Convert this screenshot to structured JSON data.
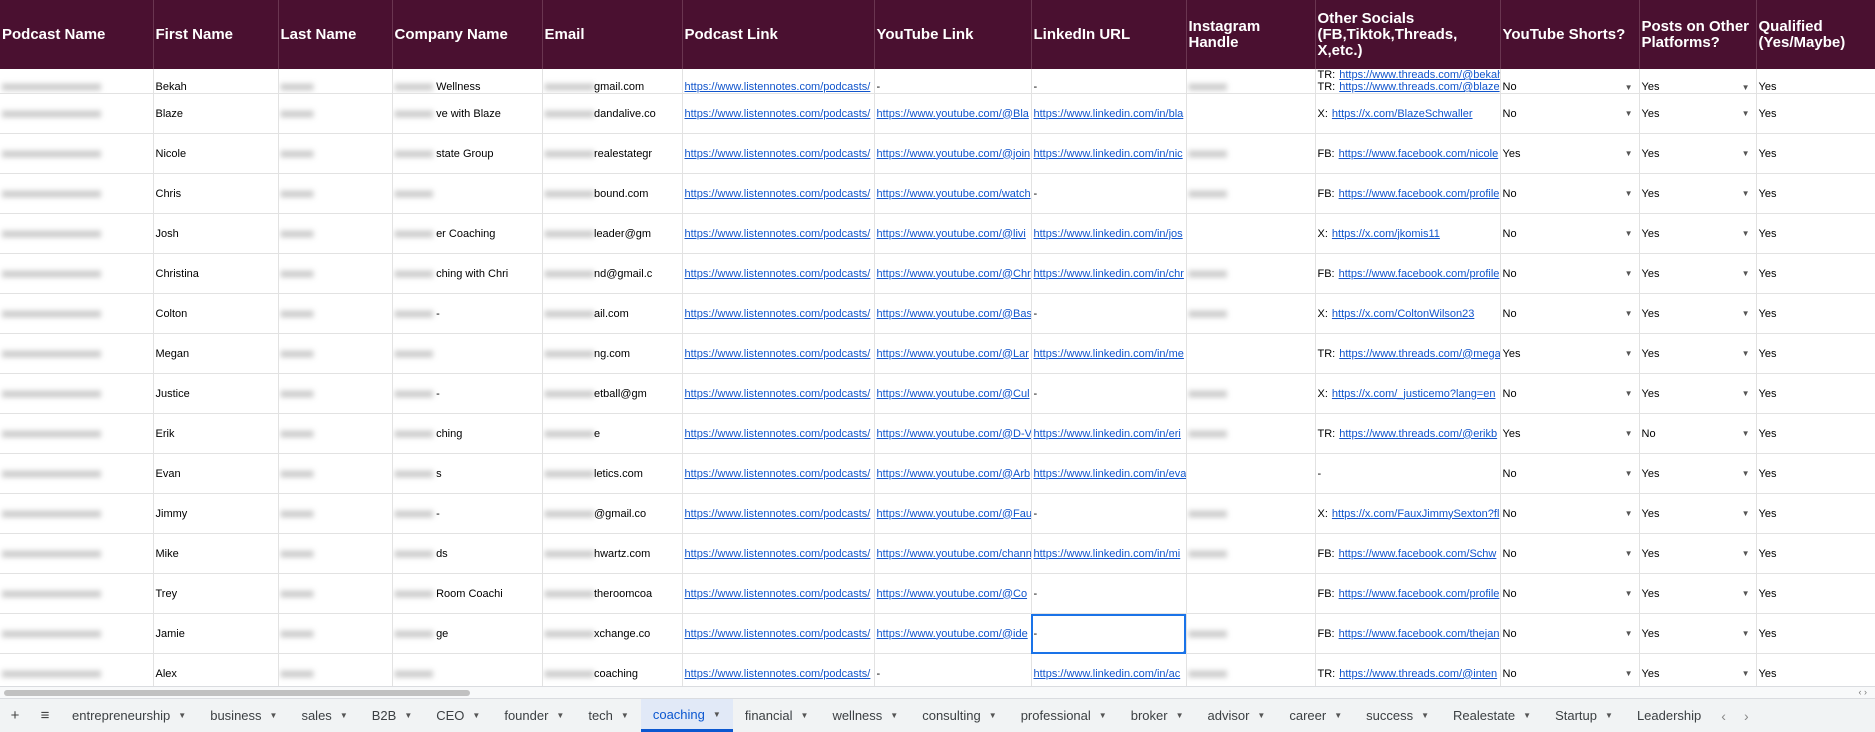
{
  "columns": [
    "Podcast Name",
    "First Name",
    "Last Name",
    "Company Name",
    "Email",
    "Podcast Link",
    "YouTube Link",
    "LinkedIn URL",
    "Instagram Handle",
    "Other Socials (FB,Tiktok,Threads, X,etc.)",
    "YouTube Shorts?",
    "Posts on Other Platforms?",
    "Qualified (Yes/Maybe)"
  ],
  "rows": [
    {
      "podcast": "",
      "first": "Bekah",
      "last": "",
      "company": "Wellness",
      "email": "gmail.com",
      "podcast_link": "https://www.listennotes.com/podcasts/",
      "youtube": "-",
      "linkedin": "-",
      "instagram": "",
      "socials": [
        {
          "label": "TR:",
          "url": "https://www.threads.com/@bekah"
        },
        {
          "label": "TR:",
          "url": "https://www.threads.com/@blaze"
        }
      ],
      "shorts": "No",
      "posts": "Yes",
      "qualified": "Yes"
    },
    {
      "podcast": "",
      "first": "Blaze",
      "last": "",
      "company": "ve with Blaze",
      "email": "dandalive.co",
      "podcast_link": "https://www.listennotes.com/podcasts/",
      "youtube": "https://www.youtube.com/@Bla",
      "linkedin": "https://www.linkedin.com/in/bla",
      "instagram": "",
      "socials": [
        {
          "label": "X:",
          "url": "https://x.com/BlazeSchwaller"
        }
      ],
      "shorts": "No",
      "posts": "Yes",
      "qualified": "Yes"
    },
    {
      "podcast": "",
      "first": "Nicole",
      "last": "",
      "company": "state Group",
      "email": "realestategr",
      "podcast_link": "https://www.listennotes.com/podcasts/",
      "youtube": "https://www.youtube.com/@join",
      "linkedin": "https://www.linkedin.com/in/nic",
      "instagram": "",
      "socials": [
        {
          "label": "FB:",
          "url": "https://www.facebook.com/nicole"
        }
      ],
      "shorts": "Yes",
      "posts": "Yes",
      "qualified": "Yes"
    },
    {
      "podcast": "",
      "first": "Chris",
      "last": "",
      "company": "",
      "email": "bound.com",
      "podcast_link": "https://www.listennotes.com/podcasts/",
      "youtube": "https://www.youtube.com/watch",
      "linkedin": "-",
      "instagram": "",
      "socials": [
        {
          "label": "FB:",
          "url": "https://www.facebook.com/profile"
        }
      ],
      "shorts": "No",
      "posts": "Yes",
      "qualified": "Yes"
    },
    {
      "podcast": "",
      "first": "Josh",
      "last": "",
      "company": "er Coaching",
      "email": "leader@gm",
      "podcast_link": "https://www.listennotes.com/podcasts/",
      "youtube": "https://www.youtube.com/@livi",
      "linkedin": "https://www.linkedin.com/in/jos",
      "instagram": "",
      "socials": [
        {
          "label": "X:",
          "url": "https://x.com/jkomis11"
        }
      ],
      "shorts": "No",
      "posts": "Yes",
      "qualified": "Yes"
    },
    {
      "podcast": "",
      "first": "Christina",
      "last": "",
      "company": "ching with Chri",
      "email": "nd@gmail.c",
      "podcast_link": "https://www.listennotes.com/podcasts/",
      "youtube": "https://www.youtube.com/@Chr",
      "linkedin": "https://www.linkedin.com/in/chr",
      "instagram": "",
      "socials": [
        {
          "label": "FB:",
          "url": "https://www.facebook.com/profile"
        }
      ],
      "shorts": "No",
      "posts": "Yes",
      "qualified": "Yes"
    },
    {
      "podcast": "",
      "first": "Colton",
      "last": "",
      "company": "-",
      "email": "ail.com",
      "podcast_link": "https://www.listennotes.com/podcasts/",
      "youtube": "https://www.youtube.com/@Bas",
      "linkedin": "-",
      "instagram": "",
      "socials": [
        {
          "label": "X:",
          "url": "https://x.com/ColtonWilson23"
        }
      ],
      "shorts": "No",
      "posts": "Yes",
      "qualified": "Yes"
    },
    {
      "podcast": "",
      "first": "Megan",
      "last": "",
      "company": "",
      "email": "ng.com",
      "podcast_link": "https://www.listennotes.com/podcasts/",
      "youtube": "https://www.youtube.com/@Lar",
      "linkedin": "https://www.linkedin.com/in/me",
      "instagram": "",
      "socials": [
        {
          "label": "TR:",
          "url": "https://www.threads.com/@mega"
        }
      ],
      "shorts": "Yes",
      "posts": "Yes",
      "qualified": "Yes"
    },
    {
      "podcast": "",
      "first": "Justice",
      "last": "",
      "company": "-",
      "email": "etball@gm",
      "podcast_link": "https://www.listennotes.com/podcasts/",
      "youtube": "https://www.youtube.com/@Cul",
      "linkedin": "-",
      "instagram": "",
      "socials": [
        {
          "label": "X:",
          "url": "https://x.com/_justicemo?lang=en"
        }
      ],
      "shorts": "No",
      "posts": "Yes",
      "qualified": "Yes"
    },
    {
      "podcast": "",
      "first": "Erik",
      "last": "",
      "company": "ching",
      "email": "e",
      "podcast_link": "https://www.listennotes.com/podcasts/",
      "youtube": "https://www.youtube.com/@D-V",
      "linkedin": "https://www.linkedin.com/in/eri",
      "instagram": "",
      "socials": [
        {
          "label": "TR:",
          "url": "https://www.threads.com/@erikb"
        }
      ],
      "shorts": "Yes",
      "posts": "No",
      "qualified": "Yes"
    },
    {
      "podcast": "",
      "first": "Evan",
      "last": "",
      "company": "s",
      "email": "letics.com",
      "podcast_link": "https://www.listennotes.com/podcasts/",
      "youtube": "https://www.youtube.com/@Arb",
      "linkedin": "https://www.linkedin.com/in/eva",
      "instagram": "",
      "socials": [
        {
          "label": "-",
          "url": ""
        }
      ],
      "shorts": "No",
      "posts": "Yes",
      "qualified": "Yes"
    },
    {
      "podcast": "",
      "first": "Jimmy",
      "last": "",
      "company": "-",
      "email": "@gmail.co",
      "podcast_link": "https://www.listennotes.com/podcasts/",
      "youtube": "https://www.youtube.com/@Fau",
      "linkedin": "-",
      "instagram": "",
      "socials": [
        {
          "label": "X:",
          "url": "https://x.com/FauxJimmySexton?fl"
        }
      ],
      "shorts": "No",
      "posts": "Yes",
      "qualified": "Yes"
    },
    {
      "podcast": "",
      "first": "Mike",
      "last": "",
      "company": "ds",
      "email": "hwartz.com",
      "podcast_link": "https://www.listennotes.com/podcasts/",
      "youtube": "https://www.youtube.com/chann",
      "linkedin": "https://www.linkedin.com/in/mi",
      "instagram": "",
      "socials": [
        {
          "label": "FB:",
          "url": "https://www.facebook.com/Schw"
        }
      ],
      "shorts": "No",
      "posts": "Yes",
      "qualified": "Yes"
    },
    {
      "podcast": "",
      "first": "Trey",
      "last": "",
      "company": "Room Coachi",
      "email": "theroomcoa",
      "podcast_link": "https://www.listennotes.com/podcasts/",
      "youtube": "https://www.youtube.com/@Co",
      "linkedin": "-",
      "instagram": "",
      "socials": [
        {
          "label": "FB:",
          "url": "https://www.facebook.com/profile"
        }
      ],
      "shorts": "No",
      "posts": "Yes",
      "qualified": "Yes"
    },
    {
      "podcast": "",
      "first": "Jamie",
      "last": "",
      "company": "ge",
      "email": "xchange.co",
      "podcast_link": "https://www.listennotes.com/podcasts/",
      "youtube": "https://www.youtube.com/@ide",
      "linkedin": "-",
      "instagram": "",
      "socials": [
        {
          "label": "FB:",
          "url": "https://www.facebook.com/thejan"
        }
      ],
      "shorts": "No",
      "posts": "Yes",
      "qualified": "Yes"
    },
    {
      "podcast": "",
      "first": "Alex",
      "last": "",
      "company": "",
      "email": "coaching",
      "podcast_link": "https://www.listennotes.com/podcasts/",
      "youtube": "-",
      "linkedin": "https://www.linkedin.com/in/ac",
      "instagram": "",
      "socials": [
        {
          "label": "TR:",
          "url": "https://www.threads.com/@inten"
        }
      ],
      "shorts": "No",
      "posts": "Yes",
      "qualified": "Yes"
    }
  ],
  "sheet_tabs": [
    "entrepreneurship",
    "business",
    "sales",
    "B2B",
    "CEO",
    "founder",
    "tech",
    "coaching",
    "financial",
    "wellness",
    "consulting",
    "professional",
    "broker",
    "advisor",
    "career",
    "success",
    "Realestate",
    "Startup",
    "Leadership"
  ],
  "active_tab": "coaching",
  "colors": {
    "header_bg": "#4a1030",
    "link": "#1155cc",
    "active_tab": "#0b57d0",
    "selection": "#1a73e8"
  },
  "icons": {
    "add_sheet": "plus-icon",
    "all_sheets": "menu-icon",
    "tab_dropdown": "caret-down-icon",
    "prev": "chevron-left-icon",
    "next": "chevron-right-icon"
  }
}
